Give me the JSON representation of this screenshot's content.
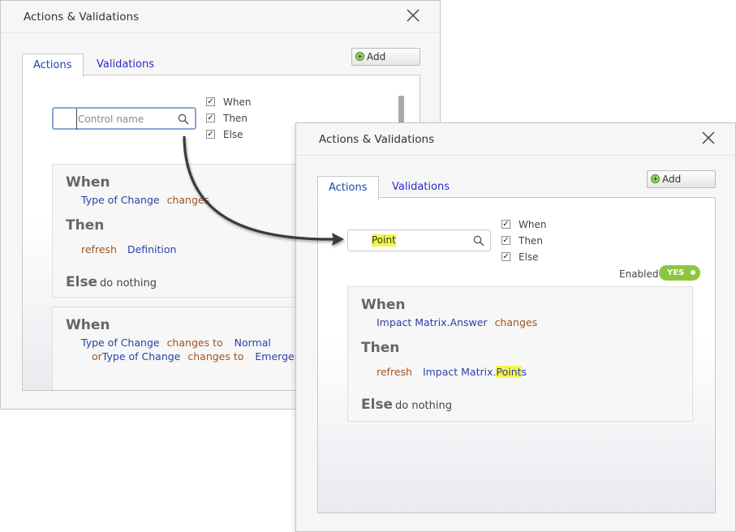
{
  "colors": {
    "accent_tab": "#1a46a8",
    "toggle_on": "#8cc63f",
    "highlight": "#f5f54a"
  },
  "dialog_back": {
    "title": "Actions & Validations",
    "tabs": [
      "Actions",
      "Validations"
    ],
    "add_label": "Add",
    "search_placeholder": "Control name",
    "filters": [
      "When",
      "Then",
      "Else"
    ],
    "rule1": {
      "when_kw": "When",
      "when_ctrl": "Type of Change",
      "when_op": "changes",
      "then_kw": "Then",
      "then_action": "refresh",
      "then_target": "Definition",
      "else_kw": "Else",
      "else_text": "do nothing"
    },
    "rule2": {
      "when_kw": "When",
      "line1_ctrl": "Type of Change",
      "line1_op": "changes to",
      "line1_val": "Normal",
      "line2_conj": "or",
      "line2_ctrl": "Type of Change",
      "line2_op": "changes to",
      "line2_val": "Emergency"
    }
  },
  "dialog_front": {
    "title": "Actions & Validations",
    "tabs": [
      "Actions",
      "Validations"
    ],
    "add_label": "Add",
    "search_value": "Point",
    "filters": [
      "When",
      "Then",
      "Else"
    ],
    "enabled_label": "Enabled",
    "toggle_label": "YES",
    "rule": {
      "when_kw": "When",
      "when_ctrl": "Impact Matrix.Answer",
      "when_op": "changes",
      "then_kw": "Then",
      "then_action": "refresh",
      "then_target_prefix": "Impact Matrix.",
      "then_target_match": "Point",
      "then_target_suffix": "s",
      "else_kw": "Else",
      "else_text": "do nothing"
    }
  }
}
